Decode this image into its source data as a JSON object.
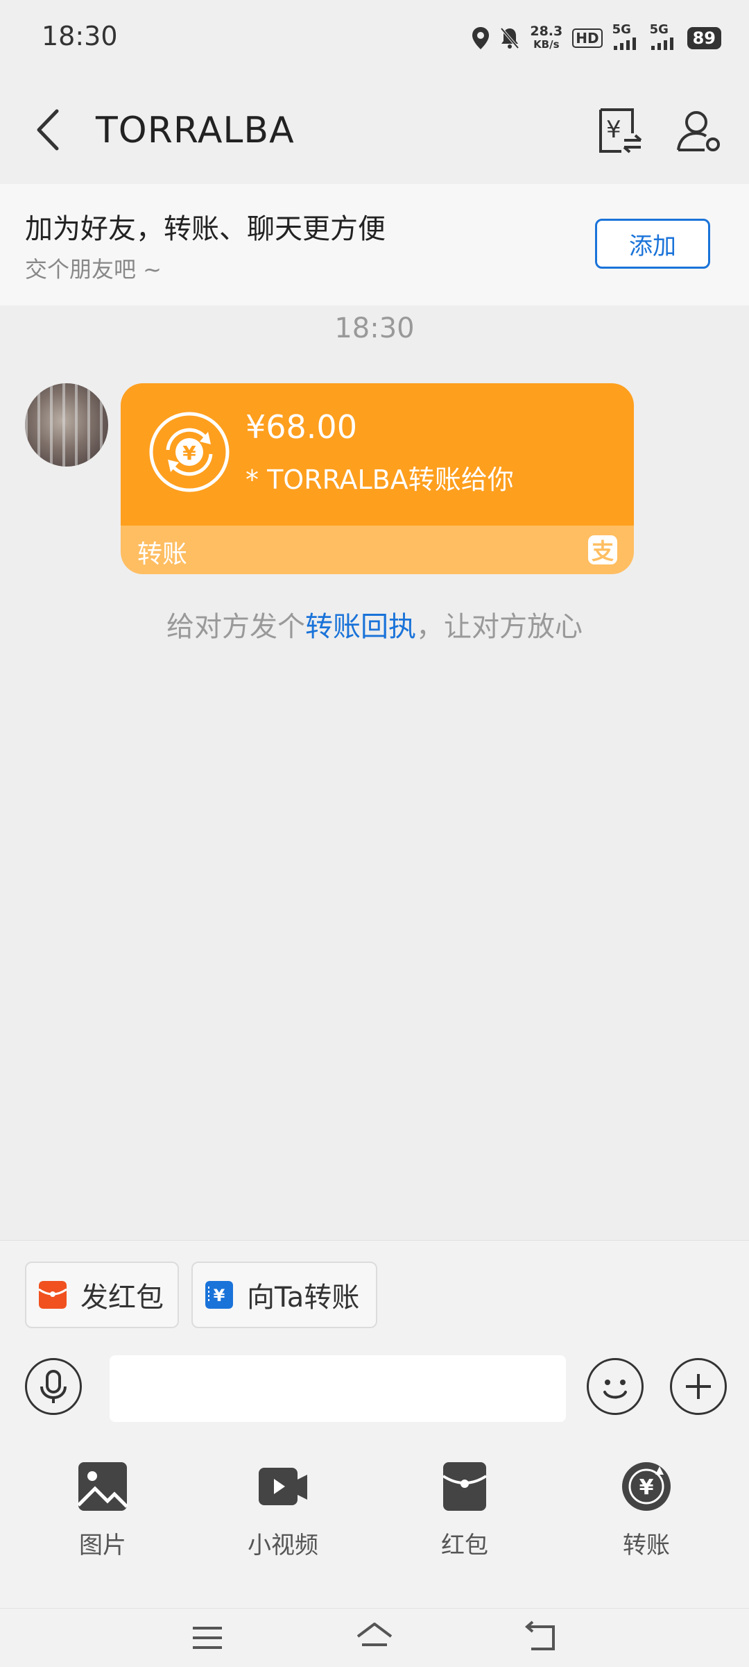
{
  "status_bar": {
    "time": "18:30",
    "speed_value": "28.3",
    "speed_unit": "KB/s",
    "hd_label": "HD",
    "net1": "5G",
    "net2": "5G",
    "battery": "89"
  },
  "header": {
    "title": "TORRALBA"
  },
  "banner": {
    "title": "加为好友，转账、聊天更方便",
    "subtitle": "交个朋友吧 ~",
    "add_label": "添加"
  },
  "chat": {
    "time": "18:30",
    "transfer": {
      "amount": "¥68.00",
      "description": "* TORRALBA转账给你",
      "tag": "转账",
      "brand_glyph": "支"
    },
    "receipt_prefix": "给对方发个",
    "receipt_link": "转账回执",
    "receipt_suffix": "，让对方放心"
  },
  "quick_actions": {
    "red_packet": "发红包",
    "transfer_to": "向Ta转账"
  },
  "input": {
    "placeholder": ""
  },
  "tools": [
    {
      "label": "图片",
      "icon": "image-icon"
    },
    {
      "label": "小视频",
      "icon": "video-icon"
    },
    {
      "label": "红包",
      "icon": "red-packet-icon"
    },
    {
      "label": "转账",
      "icon": "transfer-icon"
    }
  ],
  "colors": {
    "accent_blue": "#1a73d9",
    "card_orange": "#fe9f1e",
    "card_orange_light": "#ffbe62",
    "red_packet": "#f0511f"
  }
}
